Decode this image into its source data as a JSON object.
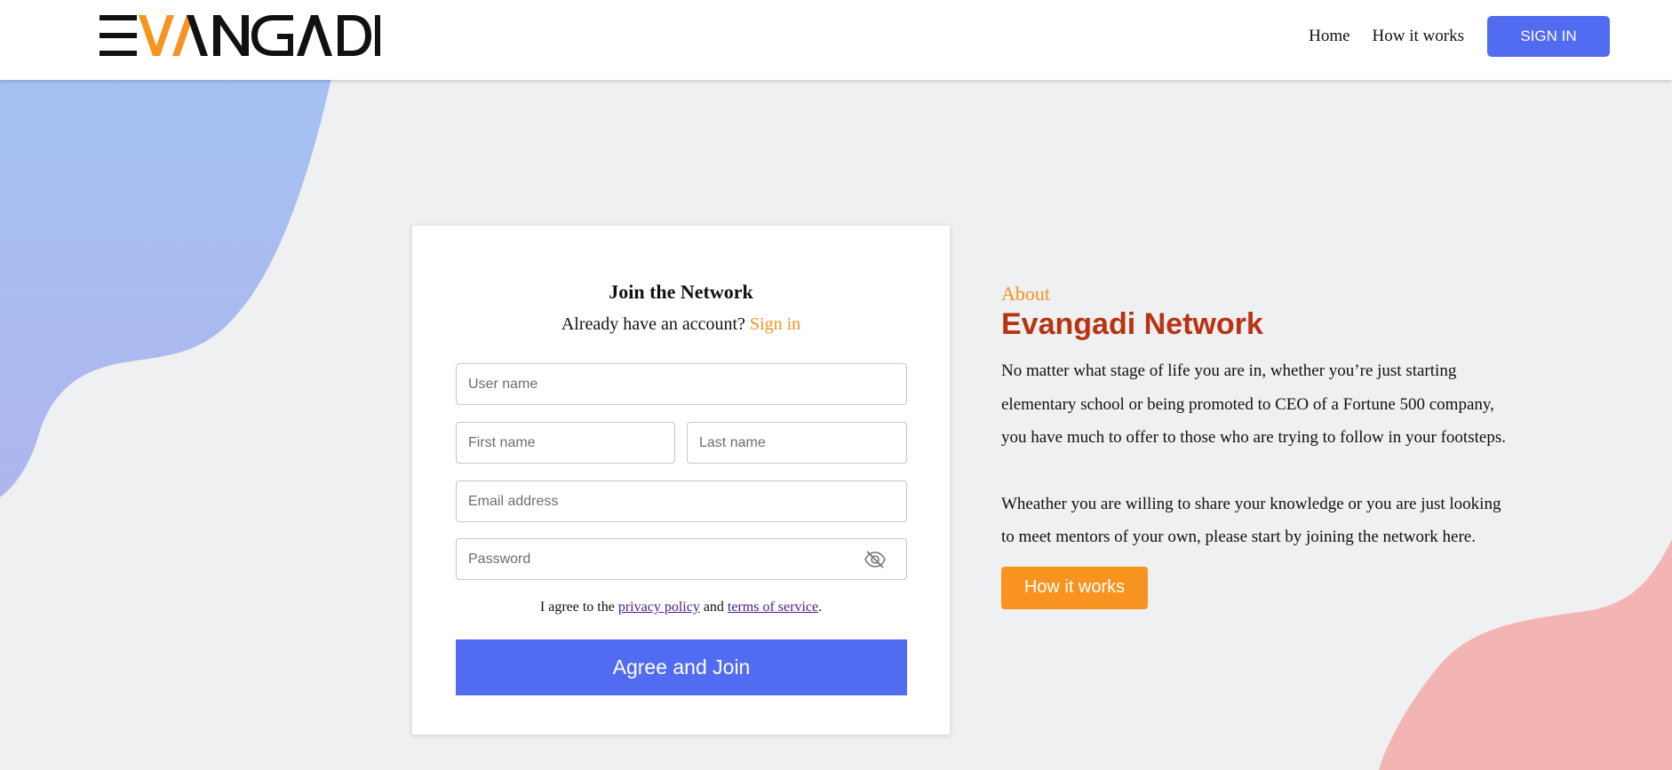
{
  "header": {
    "logo_text": "EVANGADI",
    "nav": [
      {
        "label": "Home"
      },
      {
        "label": "How it works"
      }
    ],
    "signin_label": "SIGN IN"
  },
  "form": {
    "title": "Join the Network",
    "subtitle_prefix": "Already have an account?",
    "signin_link": "Sign in",
    "fields": {
      "username_placeholder": "User name",
      "firstname_placeholder": "First name",
      "lastname_placeholder": "Last name",
      "email_placeholder": "Email address",
      "password_placeholder": "Password"
    },
    "password_toggle_icon": "eye-slash-icon",
    "agree_prefix": "I agree to the",
    "privacy_link": "privacy policy",
    "agree_and": "and",
    "terms_link": "terms of service",
    "agree_suffix": ".",
    "submit_label": "Agree and Join"
  },
  "about": {
    "label": "About",
    "title": "Evangadi Network",
    "paragraph1": "No matter what stage of life you are in, whether you’re just starting elementary school or being promoted to CEO of a Fortune 500 company, you have much to offer to those who are trying to follow in your footsteps.",
    "paragraph2": "Wheather you are willing to share your knowledge or you are just looking to meet mentors of your own, please start by joining the network here.",
    "button_label": "How it works"
  },
  "colors": {
    "accent_blue": "#516cf0",
    "accent_orange": "#f7931e",
    "title_red": "#b83312",
    "blob_blue": "#a3c0f3",
    "blob_pink": "#f3b4b4"
  }
}
